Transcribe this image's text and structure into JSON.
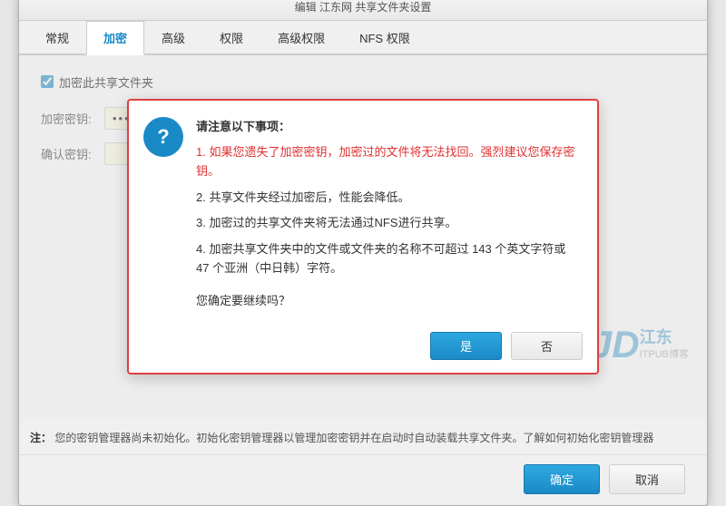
{
  "window": {
    "title": "编辑 江东网 共享文件夹设置"
  },
  "tabs": [
    {
      "label": "常规",
      "active": false
    },
    {
      "label": "加密",
      "active": true
    },
    {
      "label": "高级",
      "active": false
    },
    {
      "label": "权限",
      "active": false
    },
    {
      "label": "高级权限",
      "active": false
    },
    {
      "label": "NFS 权限",
      "active": false
    }
  ],
  "form": {
    "checkbox_label": "加密此共享文件夹",
    "checkbox_checked": true,
    "password_label": "加密密钥:",
    "password_value": "••••••••••••••••",
    "confirm_label": "确认密钥:"
  },
  "note": {
    "label": "注：",
    "text": "您的密钥管理器尚未初始化。初始化密钥管理器以管理加密密钥并在启动时自动装载共享文件夹。了解如何初始化密钥管理器"
  },
  "footer": {
    "ok": "确定",
    "cancel": "取消"
  },
  "dialog": {
    "title": "请注意以下事项：",
    "items": [
      {
        "text": "如果您遗失了加密密钥，加密过的文件将无法找回。强烈建议您保存密钥。",
        "warning": true
      },
      {
        "text": "2. 共享文件夹经过加密后，性能会降低。",
        "warning": false
      },
      {
        "text": "3. 加密过的共享文件夹将无法通过NFS进行共享。",
        "warning": false
      },
      {
        "text": "4. 加密共享文件夹中的文件或文件夹的名称不可超过 143 个英文字符或 47 个亚洲（中日韩）字符。",
        "warning": false
      }
    ],
    "question": "您确定要继续吗？",
    "yes_label": "是",
    "no_label": "否"
  },
  "watermark": {
    "jd": "JD",
    "cn": "江东",
    "url": "ITPUB博客"
  }
}
